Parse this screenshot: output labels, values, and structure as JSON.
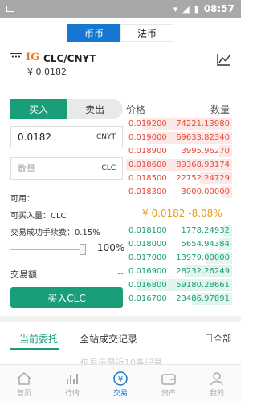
{
  "status": {
    "time": "08:57"
  },
  "top_tabs": [
    "币币",
    "法币"
  ],
  "pair": {
    "logo_text": "IG",
    "name": "CLC/CNYT",
    "price": "¥ 0.0182"
  },
  "side_tabs": {
    "buy": "买入",
    "sell": "卖出"
  },
  "columns": {
    "price": "价格",
    "qty": "数量"
  },
  "form": {
    "price_value": "0.0182",
    "price_unit": "CNYT",
    "qty_placeholder": "数量",
    "qty_unit": "CLC",
    "available": "可用：",
    "can_buy": "可买入量：CLC",
    "fee": "交易成功手续费：0.15%",
    "slider_value": 100,
    "percent": "100%",
    "amount_label": "交易额",
    "amount_value": "--",
    "submit": "买入CLC"
  },
  "asks": [
    {
      "price": "0.019200",
      "qty": "74221.13980",
      "depth": 0.85
    },
    {
      "price": "0.019000",
      "qty": "69633.82340",
      "depth": 0.8
    },
    {
      "price": "0.018900",
      "qty": "3995.96270",
      "depth": 0.12
    },
    {
      "price": "0.018600",
      "qty": "89368.93174",
      "depth": 1.0
    },
    {
      "price": "0.018500",
      "qty": "22752.24729",
      "depth": 0.3
    },
    {
      "price": "0.018300",
      "qty": "3000.00000",
      "depth": 0.1
    }
  ],
  "last_price": "¥ 0.0182",
  "change": "-8.08%",
  "bids": [
    {
      "price": "0.018100",
      "qty": "1778.24932",
      "depth": 0.08
    },
    {
      "price": "0.018000",
      "qty": "5654.94384",
      "depth": 0.12
    },
    {
      "price": "0.017000",
      "qty": "13979.00000",
      "depth": 0.25
    },
    {
      "price": "0.016900",
      "qty": "28232.26249",
      "depth": 0.45
    },
    {
      "price": "0.016800",
      "qty": "59180.28661",
      "depth": 0.9
    },
    {
      "price": "0.016700",
      "qty": "23486.97891",
      "depth": 0.38
    }
  ],
  "order_tabs": {
    "current": "当前委托",
    "market": "全站成交记录",
    "all": "全部"
  },
  "hint": "仅显示最近10条记录",
  "nav": [
    "首页",
    "行情",
    "交易",
    "资产",
    "我的"
  ],
  "colors": {
    "accent": "#1677d2",
    "buy": "#1a9e7a",
    "sell": "#e74c3c",
    "highlight": "#e6a017"
  }
}
